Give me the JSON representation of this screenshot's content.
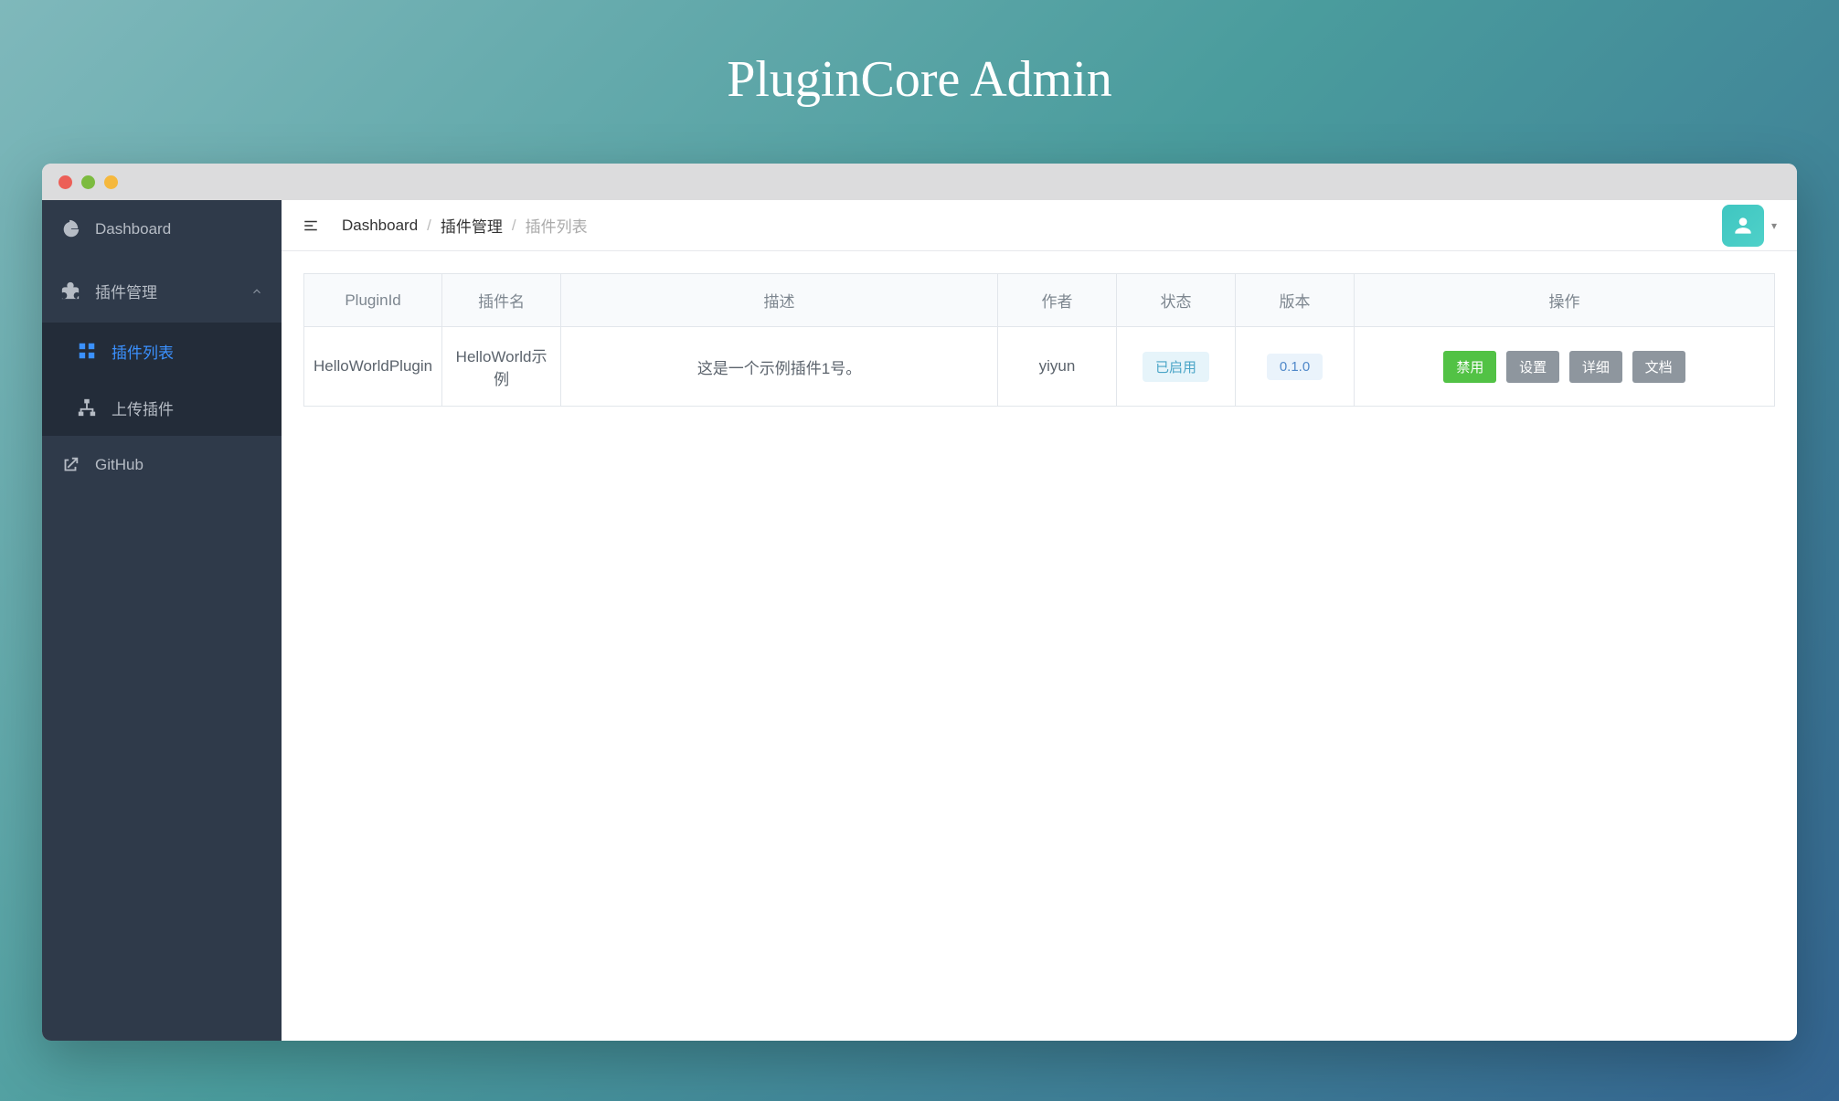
{
  "page": {
    "title": "PluginCore Admin"
  },
  "sidebar": {
    "dashboard": {
      "label": "Dashboard",
      "icon": "dashboard-icon"
    },
    "plugins": {
      "label": "插件管理",
      "icon": "plugin-icon",
      "expanded": true,
      "children": {
        "list": {
          "label": "插件列表",
          "icon": "grid-icon",
          "active": true
        },
        "upload": {
          "label": "上传插件",
          "icon": "sitemap-icon"
        }
      }
    },
    "github": {
      "label": "GitHub",
      "icon": "external-link-icon"
    }
  },
  "breadcrumb": {
    "items": [
      {
        "label": "Dashboard",
        "link": true
      },
      {
        "label": "插件管理",
        "link": true
      },
      {
        "label": "插件列表",
        "link": false
      }
    ]
  },
  "topbar": {
    "hamburger": "menu-collapse-icon",
    "avatar_icon": "user-icon"
  },
  "table": {
    "headers": {
      "plugin_id": "PluginId",
      "name": "插件名",
      "desc": "描述",
      "author": "作者",
      "status": "状态",
      "version": "版本",
      "actions": "操作"
    },
    "rows": [
      {
        "plugin_id": "HelloWorldPlugin",
        "name": "HelloWorld示例",
        "desc": "这是一个示例插件1号。",
        "author": "yiyun",
        "status": "已启用",
        "version": "0.1.0",
        "actions": {
          "disable": "禁用",
          "settings": "设置",
          "detail": "详细",
          "docs": "文档"
        }
      }
    ]
  }
}
